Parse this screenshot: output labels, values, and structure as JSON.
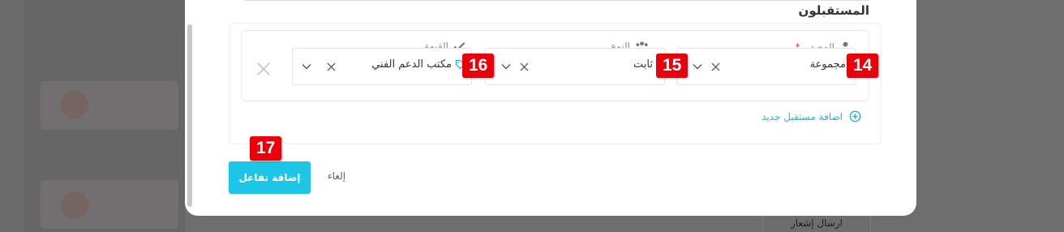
{
  "background": {
    "menu_item": "ارسال إشعار"
  },
  "section": {
    "title": "المستقبلون"
  },
  "fields": {
    "source": {
      "label": "المصدر",
      "required_mark": "*",
      "value": "مجموعة",
      "icon": "user-icon"
    },
    "type": {
      "label": "النوع",
      "value": "ثابت",
      "icon": "users-group-icon"
    },
    "value": {
      "label": "القيمة",
      "value": "مكتب الدعم الفني",
      "icon": "check-icon",
      "value_icon": "tag-icon"
    }
  },
  "add_recipient": {
    "label": "اضافة مستقبل جديد",
    "icon": "plus-circle-icon"
  },
  "buttons": {
    "submit": "إضافة تفاعل",
    "cancel": "إلغاء"
  },
  "badges": {
    "b14": "14",
    "b15": "15",
    "b16": "16",
    "b17": "17"
  },
  "colors": {
    "accent": "#1dc6e6",
    "link": "#21b6cf",
    "badge": "#e8000a",
    "required": "#e53935"
  }
}
